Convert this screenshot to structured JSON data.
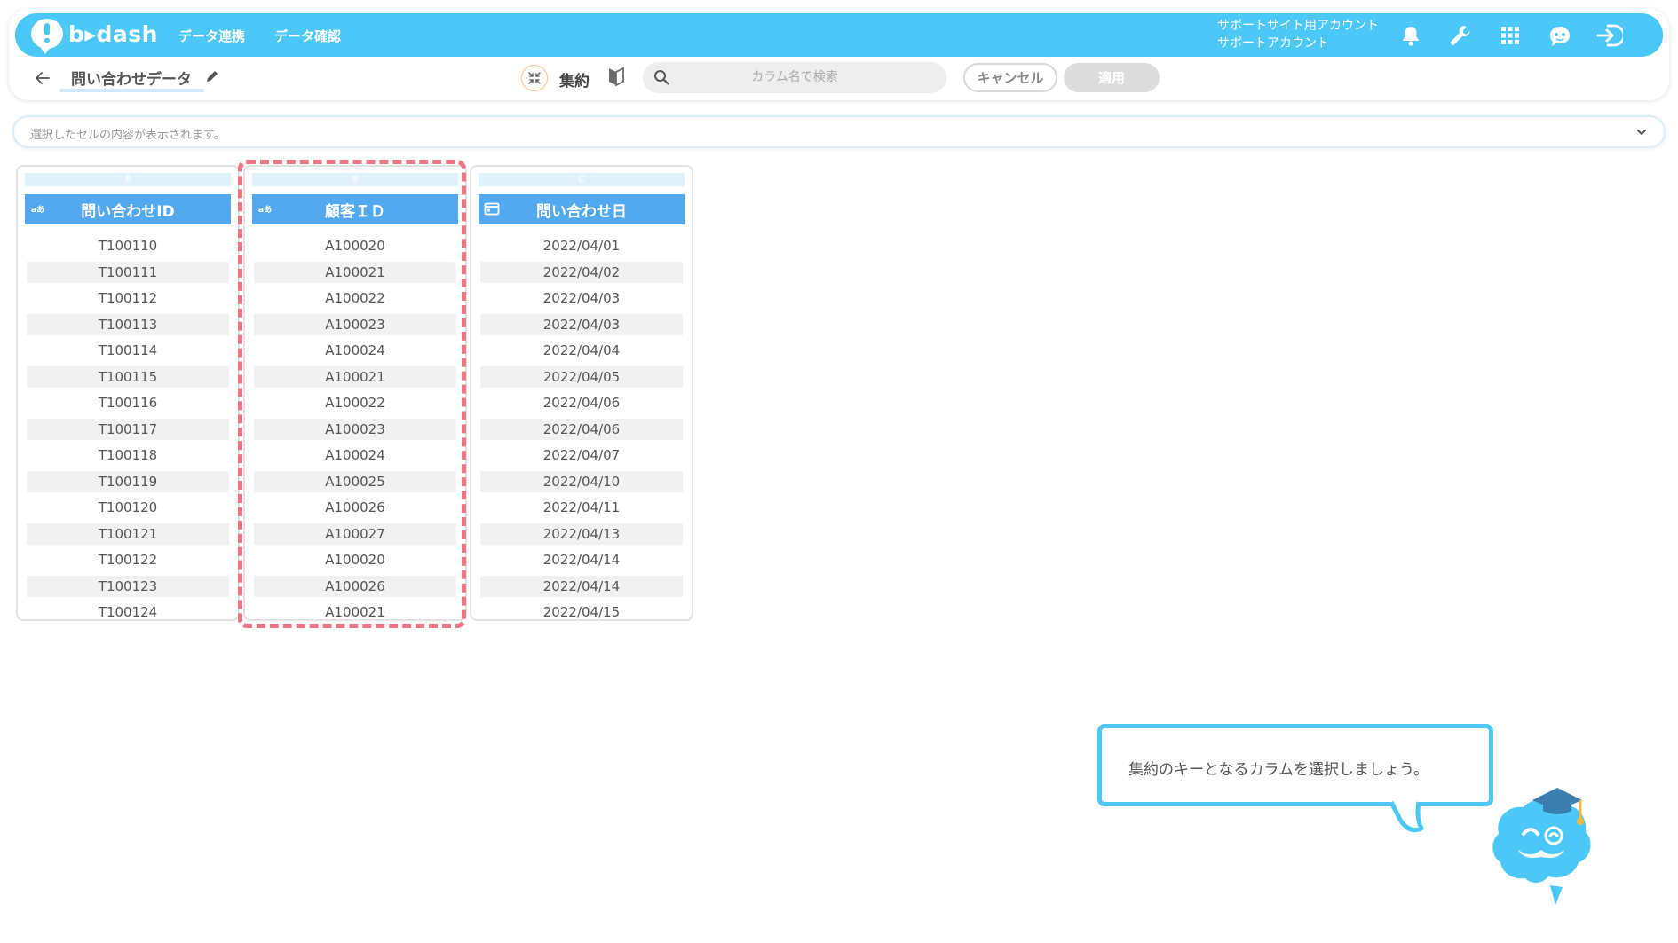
{
  "header": {
    "logo_text": "b▸dash",
    "nav": [
      "データ連携",
      "データ確認"
    ],
    "account_line1": "サポートサイト用アカウント",
    "account_line2": "サポートアカウント",
    "icons": [
      "bell-icon",
      "wrench-icon",
      "apps-grid-icon",
      "chat-mascot-icon",
      "logout-icon"
    ]
  },
  "toolbar": {
    "dataset_title": "問い合わせデータ",
    "mode_label": "集約",
    "search_placeholder": "カラム名で検索",
    "cancel_label": "キャンセル",
    "apply_label": "適用"
  },
  "cell_viewer": {
    "placeholder": "選択したセルの内容が表示されます。"
  },
  "columns": [
    {
      "letter": "A",
      "type_badge": "aあ",
      "name": "問い合わせID",
      "rows": [
        "T100110",
        "T100111",
        "T100112",
        "T100113",
        "T100114",
        "T100115",
        "T100116",
        "T100117",
        "T100118",
        "T100119",
        "T100120",
        "T100121",
        "T100122",
        "T100123",
        "T100124"
      ]
    },
    {
      "letter": "B",
      "type_badge": "aあ",
      "name": "顧客ＩＤ",
      "rows": [
        "A100020",
        "A100021",
        "A100022",
        "A100023",
        "A100024",
        "A100021",
        "A100022",
        "A100023",
        "A100024",
        "A100025",
        "A100026",
        "A100027",
        "A100020",
        "A100026",
        "A100021"
      ]
    },
    {
      "letter": "C",
      "type_badge": "calendar-icon",
      "name": "問い合わせ日",
      "rows": [
        "2022/04/01",
        "2022/04/02",
        "2022/04/03",
        "2022/04/03",
        "2022/04/04",
        "2022/04/05",
        "2022/04/06",
        "2022/04/06",
        "2022/04/07",
        "2022/04/10",
        "2022/04/11",
        "2022/04/13",
        "2022/04/14",
        "2022/04/14",
        "2022/04/15"
      ]
    }
  ],
  "tip": {
    "text": "集約のキーとなるカラムを選択しましょう。"
  },
  "colors": {
    "brand": "#4cc8f8",
    "header_col": "#52a9f0",
    "highlight": "#f07585"
  }
}
